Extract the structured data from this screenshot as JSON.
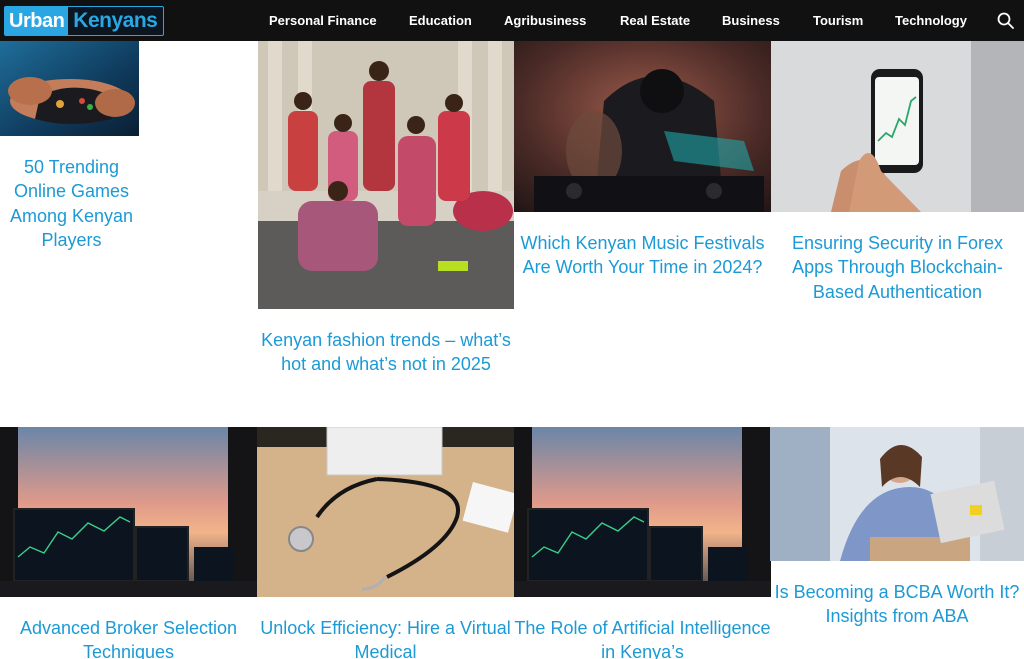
{
  "header": {
    "logo": {
      "part1": "Urban",
      "part2": "Kenyans"
    },
    "nav": [
      "Personal Finance",
      "Education",
      "Agribusiness",
      "Real Estate",
      "Business",
      "Tourism",
      "Technology"
    ],
    "search_icon": "search-icon"
  },
  "colors": {
    "accent": "#1b9ad6",
    "header_bg": "#111111",
    "logo_blue": "#2aa6e3"
  },
  "articles": [
    {
      "title": "50 Trending Online Games Among Kenyan Players",
      "image": "gamer-controller-photo"
    },
    {
      "title": "Kenyan fashion trends – what’s hot and what’s not in 2025",
      "image": "fashion-group-photo"
    },
    {
      "title": "Which Kenyan Music Festivals Are Worth Your Time in 2024?",
      "image": "dj-festival-photo"
    },
    {
      "title": "Ensuring Security in Forex Apps Through Blockchain-Based Authentication",
      "image": "phone-forex-chart-photo"
    },
    {
      "title": "Advanced Broker Selection Techniques",
      "image": "trading-monitors-sunset-photo"
    },
    {
      "title": "Unlock Efficiency: Hire a Virtual Medical",
      "image": "stethoscope-desk-photo"
    },
    {
      "title": "The Role of Artificial Intelligence in Kenya’s",
      "image": "trading-monitors-sunset-photo"
    },
    {
      "title": "Is Becoming a BCBA Worth It? Insights from ABA",
      "image": "woman-laptop-writing-photo"
    }
  ]
}
